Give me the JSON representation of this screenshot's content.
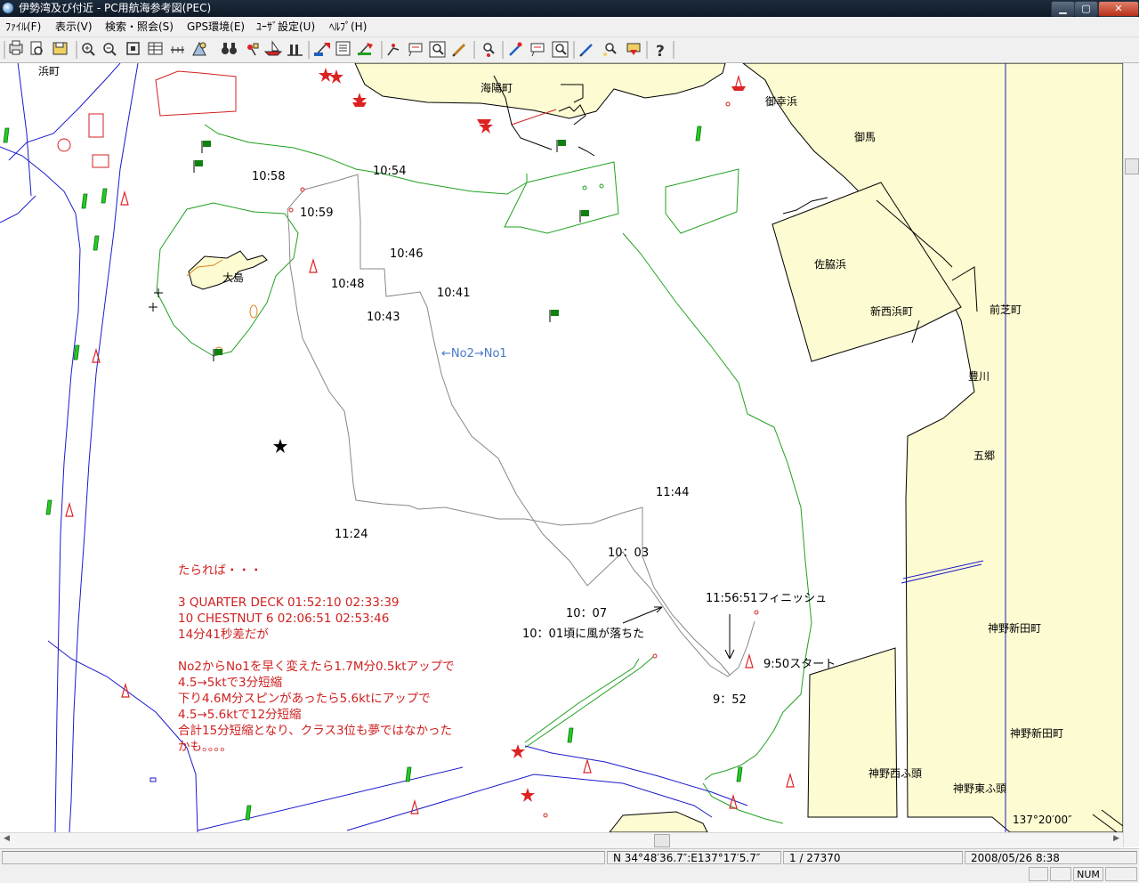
{
  "window": {
    "title": "伊勢湾及び付近 - PC用航海参考図(PEC)",
    "buttons": {
      "minimize": "▁",
      "maximize": "▢",
      "close": "✕"
    }
  },
  "menu": {
    "items": [
      "ﾌｧｲﾙ(F)",
      "表示(V)",
      "検索・照会(S)",
      "GPS環境(E)",
      "ﾕｰｻﾞ設定(U)",
      "ﾍﾙﾌﾟ(H)"
    ]
  },
  "toolbar": {
    "icons": [
      "print-icon",
      "print-preview-icon",
      "save-icon",
      "zoom-in-icon",
      "zoom-out-icon",
      "fit-view-icon",
      "layers-icon",
      "ruler-icon",
      "gps-icon",
      "binoculars-icon",
      "anchor-mark-icon",
      "boat-icon",
      "mark-icon",
      "chart-edit-icon",
      "list-icon",
      "plotter-icon",
      "route-icon",
      "text-note-icon",
      "magnify-icon",
      "pencil-icon",
      "locate-icon",
      "marker-icon",
      "comment-icon",
      "zoom-box-icon",
      "pen-icon",
      "search-mark-icon",
      "download-icon",
      "help-icon"
    ]
  },
  "map": {
    "time_labels": [
      "10:58",
      "10:54",
      "10:59",
      "10:46",
      "10:48",
      "10:41",
      "10:43",
      "11:44",
      "11:24",
      "10：03",
      "10：07",
      "11:56:51フィニッシュ",
      "9:50スタート",
      "9：52"
    ],
    "route_note": "←No2→No1",
    "wind_note": "10：01頃に風が落ちた",
    "places": [
      "浜町",
      "海陽町",
      "御幸浜",
      "御馬",
      "大島",
      "佐脇浜",
      "新西浜町",
      "前芝町",
      "豊川",
      "五郷",
      "神野新田町",
      "神野新田町",
      "神野西ふ頭",
      "神野東ふ頭"
    ],
    "longitude_label": "137°20′00″",
    "commentary": [
      "たられば・・・",
      "",
      "3  QUARTER DECK  01:52:10  02:33:39",
      "10 CHESTNUT 6  02:06:51  02:53:46",
      "14分41秒差だが",
      "",
      "No2からNo1を早く変えたら1.7M分0.5ktアップで",
      "4.5→5ktで3分短縮",
      "下り4.6M分スピンがあったら5.6ktにアップで",
      "4.5→5.6ktで12分短縮",
      "合計15分短縮となり、クラス3位も夢ではなかった",
      "かも。。。。"
    ],
    "colors": {
      "land": "#fdfbd1",
      "green_contour": "#20a020",
      "blue_line": "#1a1acc",
      "track": "#888888",
      "note_red": "#d02020",
      "buoy_green": "#22cc22",
      "buoy_red": "#dd2222",
      "flag_green": "#108010"
    }
  },
  "status": {
    "coordinates": "N 34°48′36.7″:E137°17′5.7″",
    "scale": "1 / 27370",
    "datetime": "2008/05/26  8:38",
    "num": "NUM"
  }
}
